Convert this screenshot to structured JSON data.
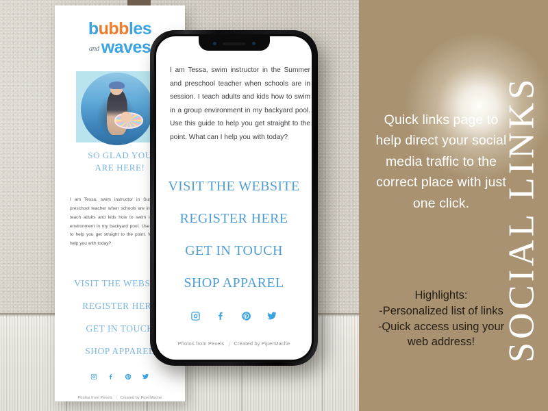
{
  "brand": {
    "logo_line1_part1": "b",
    "logo_line1_part2": "ubb",
    "logo_line1_part3": "les",
    "logo_and": "and",
    "logo_line2": "waves",
    "blue": "#3ba3e0",
    "orange": "#f07c2a"
  },
  "flyer": {
    "greeting": "SO GLAD YOU\nARE HERE!",
    "body": "I am Tessa, swim instructor in Summer and preschool teacher when schools are in session. I teach adults and kids how to swim in a group environment in my backyard pool. Use this guide to help you get straight to the point. What can I help you with today?",
    "links": [
      "VISIT THE WEBSITE",
      "REGISTER HERE",
      "GET IN TOUCH",
      "SHOP APPAREL"
    ],
    "footer_credit": "Photos from Pexels",
    "footer_sep": "|",
    "footer_author": "Created by PiperMache",
    "social": [
      "instagram-icon",
      "facebook-icon",
      "pinterest-icon",
      "twitter-icon"
    ],
    "photo_alt": "swim-instructor-with-baby-in-pool"
  },
  "phone": {
    "body": "I am Tessa, swim instructor in the Summer and preschool teacher when schools are in session. I teach adults and kids how to swim in a group environment in my backyard pool. Use this guide to help you get straight to the point. What can I help you with today?",
    "links": [
      "VISIT THE WEBSITE",
      "REGISTER HERE",
      "GET IN TOUCH",
      "SHOP APPAREL"
    ],
    "footer_credit": "Photos from Pexels",
    "footer_sep": "|",
    "footer_author": "Created by PiperMache",
    "social": [
      "instagram-icon",
      "facebook-icon",
      "pinterest-icon",
      "twitter-icon"
    ],
    "link_color": "#4f9ed4"
  },
  "panel": {
    "vertical_title": "SOCIAL LINKS",
    "description": "Quick links page to help direct your social media traffic to the correct place with just one click.",
    "highlights_title": "Highlights:",
    "highlights": [
      "-Personalized list of links",
      "-Quick access using your web address!"
    ],
    "background": "#a89272",
    "title_color": "#ffffff",
    "highlight_text_color": "#241d14"
  }
}
